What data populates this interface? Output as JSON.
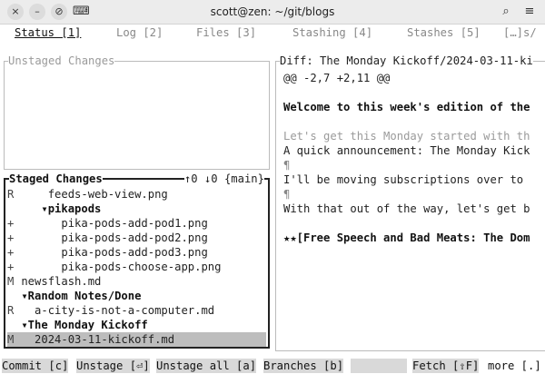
{
  "window": {
    "title": "scott@zen: ~/git/blogs",
    "icons": {
      "close": "×",
      "minimize": "–",
      "pin": "⊘",
      "terminal": "⌨",
      "search": "⌕",
      "menu": "≡"
    }
  },
  "tabs": [
    {
      "label": "Status [1]",
      "active": true
    },
    {
      "label": "Log [2]",
      "active": false
    },
    {
      "label": "Files [3]",
      "active": false
    },
    {
      "label": "Stashing [4]",
      "active": false
    },
    {
      "label": "Stashes [5]",
      "active": false
    },
    {
      "label": "[…]s/",
      "active": false
    }
  ],
  "unstaged": {
    "title": "Unstaged Changes"
  },
  "staged": {
    "title": "Staged Changes",
    "info": "↑0 ↓0 {main}",
    "rows": [
      {
        "status": "R",
        "indent": "     ",
        "name": "feeds-web-view.png",
        "kind": "file",
        "selected": false
      },
      {
        "status": "",
        "indent": "    ",
        "name": "▾pikapods",
        "kind": "dir",
        "selected": false
      },
      {
        "status": "+",
        "indent": "       ",
        "name": "pika-pods-add-pod1.png",
        "kind": "file",
        "selected": false
      },
      {
        "status": "+",
        "indent": "       ",
        "name": "pika-pods-add-pod2.png",
        "kind": "file",
        "selected": false
      },
      {
        "status": "+",
        "indent": "       ",
        "name": "pika-pods-add-pod3.png",
        "kind": "file",
        "selected": false
      },
      {
        "status": "+",
        "indent": "       ",
        "name": "pika-pods-choose-app.png",
        "kind": "file",
        "selected": false
      },
      {
        "status": "M",
        "indent": " ",
        "name": "newsflash.md",
        "kind": "file",
        "selected": false
      },
      {
        "status": "",
        "indent": " ",
        "name": "▾Random Notes/Done",
        "kind": "dir",
        "selected": false
      },
      {
        "status": "R",
        "indent": "   ",
        "name": "a-city-is-not-a-computer.md",
        "kind": "file",
        "selected": false
      },
      {
        "status": "",
        "indent": " ",
        "name": "▾The Monday Kickoff",
        "kind": "dir",
        "selected": false
      },
      {
        "status": "M",
        "indent": "   ",
        "name": "2024-03-11-kickoff.md",
        "kind": "file",
        "selected": true
      }
    ]
  },
  "diff": {
    "title": "Diff: The Monday Kickoff/2024-03-11-ki",
    "lines": [
      {
        "text": "@@ -2,7 +2,11 @@",
        "style": "normal"
      },
      {
        "text": "",
        "style": "normal"
      },
      {
        "text": "Welcome to this week's edition of the",
        "style": "bold"
      },
      {
        "text": "",
        "style": "normal"
      },
      {
        "text": "Let's get this Monday started with th",
        "style": "muted"
      },
      {
        "text": "A quick announcement: The Monday Kick",
        "style": "normal"
      },
      {
        "text": "¶",
        "style": "dim"
      },
      {
        "text": "I'll be moving subscriptions over to",
        "style": "normal"
      },
      {
        "text": "¶",
        "style": "dim"
      },
      {
        "text": "With that out of the way, let's get b",
        "style": "normal"
      },
      {
        "text": "",
        "style": "normal"
      },
      {
        "text": "★★[Free Speech and Bad Meats: The Dom",
        "style": "bold"
      }
    ]
  },
  "footer": {
    "commit": "Commit [c]",
    "unstage": "Unstage [⏎]",
    "unstage_all": "Unstage all [a]",
    "branches": "Branches [b]",
    "fetch": "Fetch [⇧F]",
    "more": "more [.]"
  }
}
